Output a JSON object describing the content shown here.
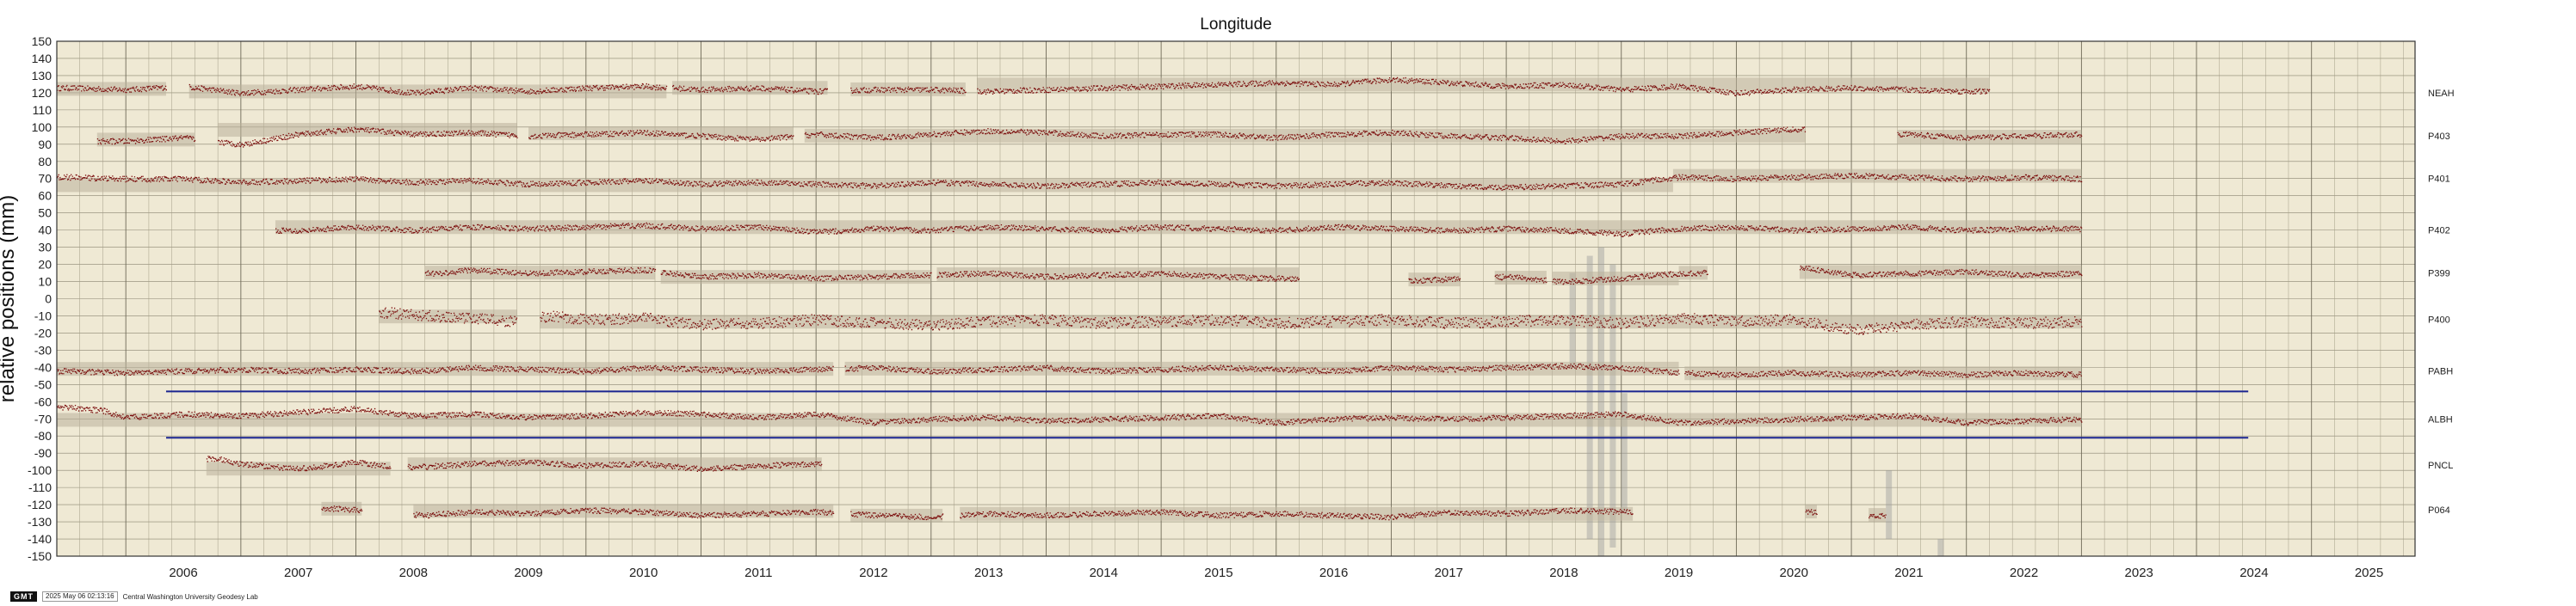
{
  "chart_data": {
    "type": "scatter",
    "title": "Longitude",
    "ylabel": "relative positions (mm)",
    "xlabel": "",
    "xlim": [
      2005.4,
      2025.9
    ],
    "ylim": [
      -150,
      150
    ],
    "x_ticks": [
      "2006",
      "2007",
      "2008",
      "2009",
      "2010",
      "2011",
      "2012",
      "2013",
      "2014",
      "2015",
      "2016",
      "2017",
      "2018",
      "2019",
      "2020",
      "2021",
      "2022",
      "2023",
      "2024",
      "2025"
    ],
    "y_ticks": [
      150,
      140,
      130,
      120,
      110,
      100,
      90,
      80,
      70,
      60,
      50,
      40,
      30,
      20,
      10,
      0,
      -10,
      -20,
      -30,
      -40,
      -50,
      -60,
      -70,
      -80,
      -90,
      -100,
      -110,
      -120,
      -130,
      -140,
      -150
    ],
    "grid": true,
    "background": "#efe9d4",
    "point_color": "#7a0a0a",
    "band_color": "#9e9e9e",
    "reference_line_color": "#1a2490",
    "series": [
      {
        "name": "NEAH",
        "offset": 120,
        "spans": [
          [
            2005.4,
            2006.35
          ],
          [
            2006.55,
            2010.7
          ],
          [
            2010.75,
            2012.1
          ],
          [
            2012.3,
            2013.3
          ],
          [
            2013.4,
            2022.2
          ]
        ],
        "x": [
          2005.5,
          2006.0,
          2006.5,
          2007.0,
          2007.5,
          2008.0,
          2008.5,
          2009.0,
          2009.5,
          2010.0,
          2010.5,
          2011.0,
          2011.5,
          2012.0,
          2012.5,
          2013.0,
          2013.5,
          2014.0,
          2014.5,
          2015.0,
          2015.5,
          2016.0,
          2016.5,
          2017.0,
          2017.5,
          2018.0,
          2018.5,
          2019.0,
          2019.5,
          2020.0,
          2020.5,
          2021.0,
          2021.5,
          2022.0
        ],
        "y": [
          123,
          122,
          124,
          120,
          122,
          124,
          120,
          123,
          121,
          123,
          124,
          122,
          123,
          121,
          122,
          122,
          121,
          122,
          123,
          124,
          125,
          126,
          125,
          128,
          126,
          124,
          125,
          122,
          124,
          120,
          122,
          123,
          122,
          121
        ]
      },
      {
        "name": "P403",
        "offset": 95,
        "spans": [
          [
            2005.75,
            2006.6
          ],
          [
            2006.8,
            2009.4
          ],
          [
            2009.5,
            2011.8
          ],
          [
            2011.9,
            2020.6
          ],
          [
            2021.4,
            2023.0
          ]
        ],
        "x": [
          2006.0,
          2006.5,
          2007.0,
          2007.5,
          2008.0,
          2008.5,
          2009.0,
          2009.5,
          2010.0,
          2010.5,
          2011.0,
          2011.5,
          2012.0,
          2012.5,
          2013.0,
          2013.5,
          2014.0,
          2014.5,
          2015.0,
          2015.5,
          2016.0,
          2016.5,
          2017.0,
          2017.5,
          2018.0,
          2018.5,
          2019.0,
          2019.5,
          2020.0,
          2020.5,
          2021.5,
          2022.0,
          2022.5,
          2023.0
        ],
        "y": [
          92,
          94,
          90,
          96,
          99,
          96,
          97,
          95,
          96,
          97,
          95,
          93,
          96,
          94,
          96,
          98,
          97,
          95,
          96,
          96,
          94,
          96,
          97,
          95,
          94,
          92,
          95,
          95,
          97,
          99,
          96,
          94,
          95,
          96
        ]
      },
      {
        "name": "P401",
        "offset": 70,
        "spans": [
          [
            2005.4,
            2019.45
          ],
          [
            2019.45,
            2023.0
          ]
        ],
        "x": [
          2005.5,
          2006.0,
          2006.5,
          2007.0,
          2007.5,
          2008.0,
          2008.5,
          2009.0,
          2009.5,
          2010.0,
          2010.5,
          2011.0,
          2011.5,
          2012.0,
          2012.5,
          2013.0,
          2013.5,
          2014.0,
          2014.5,
          2015.0,
          2015.5,
          2016.0,
          2016.5,
          2017.0,
          2017.5,
          2018.0,
          2018.5,
          2019.0,
          2019.5,
          2020.0,
          2020.5,
          2021.0,
          2021.5,
          2022.0,
          2022.5,
          2023.0
        ],
        "y": [
          71,
          70,
          70,
          68,
          69,
          70,
          68,
          69,
          67,
          68,
          69,
          67,
          68,
          67,
          66,
          68,
          67,
          66,
          67,
          68,
          67,
          66,
          67,
          68,
          66,
          65,
          66,
          67,
          71,
          70,
          71,
          72,
          71,
          70,
          71,
          70
        ]
      },
      {
        "name": "P402",
        "offset": 40,
        "spans": [
          [
            2007.3,
            2023.0
          ]
        ],
        "x": [
          2007.5,
          2008.0,
          2008.5,
          2009.0,
          2009.5,
          2010.0,
          2010.5,
          2011.0,
          2011.5,
          2012.0,
          2012.5,
          2013.0,
          2013.5,
          2014.0,
          2014.5,
          2015.0,
          2015.5,
          2016.0,
          2016.5,
          2017.0,
          2017.5,
          2018.0,
          2018.5,
          2019.0,
          2019.5,
          2020.0,
          2020.5,
          2021.0,
          2021.5,
          2022.0,
          2022.5,
          2023.0
        ],
        "y": [
          40,
          42,
          40,
          42,
          41,
          42,
          43,
          41,
          42,
          39,
          41,
          40,
          42,
          41,
          40,
          42,
          41,
          40,
          42,
          41,
          40,
          41,
          40,
          38,
          41,
          42,
          40,
          41,
          42,
          40,
          41,
          41
        ]
      },
      {
        "name": "P399",
        "offset": 15,
        "spans": [
          [
            2008.6,
            2010.6
          ],
          [
            2010.65,
            2013.0
          ],
          [
            2013.05,
            2016.2
          ],
          [
            2017.15,
            2017.6
          ],
          [
            2017.9,
            2018.35
          ],
          [
            2018.4,
            2019.5
          ],
          [
            2019.5,
            2019.75
          ],
          [
            2020.55,
            2023.0
          ]
        ],
        "x": [
          2008.7,
          2009.0,
          2009.5,
          2010.0,
          2010.5,
          2011.0,
          2011.5,
          2012.0,
          2012.5,
          2013.0,
          2013.5,
          2014.0,
          2014.5,
          2015.0,
          2015.5,
          2016.0,
          2017.3,
          2018.0,
          2018.5,
          2019.0,
          2019.3,
          2019.6,
          2020.6,
          2021.0,
          2021.5,
          2022.0,
          2022.5,
          2023.0
        ],
        "y": [
          15,
          17,
          15,
          16,
          17,
          13,
          14,
          12,
          13,
          14,
          15,
          13,
          14,
          15,
          13,
          12,
          11,
          13,
          10,
          12,
          14,
          15,
          18,
          14,
          15,
          16,
          14,
          15
        ]
      },
      {
        "name": "P400",
        "offset": -12,
        "spans": [
          [
            2008.2,
            2009.4
          ],
          [
            2009.6,
            2023.0
          ]
        ],
        "x": [
          2008.3,
          2008.7,
          2009.0,
          2009.3,
          2009.7,
          2010.0,
          2010.5,
          2011.0,
          2011.5,
          2012.0,
          2012.5,
          2013.0,
          2013.5,
          2014.0,
          2014.5,
          2015.0,
          2015.5,
          2016.0,
          2016.5,
          2017.0,
          2017.5,
          2018.0,
          2018.5,
          2019.0,
          2019.5,
          2020.0,
          2020.5,
          2021.0,
          2021.5,
          2022.0,
          2022.5,
          2023.0
        ],
        "y": [
          -8,
          -10,
          -11,
          -13,
          -10,
          -12,
          -11,
          -15,
          -14,
          -12,
          -14,
          -15,
          -13,
          -12,
          -14,
          -13,
          -12,
          -14,
          -13,
          -12,
          -14,
          -13,
          -12,
          -14,
          -11,
          -13,
          -12,
          -18,
          -15,
          -13,
          -14,
          -13
        ]
      },
      {
        "name": "PABH",
        "offset": -42,
        "spans": [
          [
            2005.4,
            2012.15
          ],
          [
            2012.25,
            2019.5
          ],
          [
            2019.55,
            2023.0
          ]
        ],
        "x": [
          2005.5,
          2006.0,
          2006.5,
          2007.0,
          2007.5,
          2008.0,
          2008.5,
          2009.0,
          2009.5,
          2010.0,
          2010.5,
          2011.0,
          2011.5,
          2012.0,
          2012.5,
          2013.0,
          2013.5,
          2014.0,
          2014.5,
          2015.0,
          2015.5,
          2016.0,
          2016.5,
          2017.0,
          2017.5,
          2018.0,
          2018.5,
          2019.0,
          2019.5,
          2020.0,
          2020.5,
          2021.0,
          2021.5,
          2022.0,
          2022.5,
          2023.0
        ],
        "y": [
          -42,
          -43,
          -42,
          -41,
          -42,
          -41,
          -42,
          -40,
          -41,
          -42,
          -40,
          -41,
          -42,
          -41,
          -40,
          -42,
          -41,
          -40,
          -42,
          -41,
          -40,
          -41,
          -42,
          -40,
          -41,
          -40,
          -39,
          -40,
          -43,
          -44,
          -43,
          -44,
          -43,
          -44,
          -43,
          -44
        ]
      },
      {
        "name": "ALBH",
        "offset": -70,
        "spans": [
          [
            2005.4,
            2023.0
          ]
        ],
        "x": [
          2005.5,
          2005.8,
          2006.0,
          2006.5,
          2007.0,
          2007.5,
          2008.0,
          2008.5,
          2009.0,
          2009.5,
          2010.0,
          2010.5,
          2011.0,
          2011.5,
          2012.0,
          2012.5,
          2013.0,
          2013.5,
          2014.0,
          2014.5,
          2015.0,
          2015.5,
          2016.0,
          2016.5,
          2017.0,
          2017.5,
          2018.0,
          2018.5,
          2019.0,
          2019.5,
          2020.0,
          2020.5,
          2021.0,
          2021.5,
          2022.0,
          2022.5,
          2023.0
        ],
        "y": [
          -63,
          -65,
          -69,
          -67,
          -68,
          -66,
          -64,
          -68,
          -67,
          -69,
          -68,
          -66,
          -67,
          -69,
          -67,
          -72,
          -70,
          -69,
          -71,
          -70,
          -69,
          -68,
          -72,
          -70,
          -69,
          -70,
          -69,
          -68,
          -67,
          -72,
          -71,
          -70,
          -69,
          -68,
          -72,
          -71,
          -70
        ]
      },
      {
        "name": "PNCL",
        "offset": -97,
        "spans": [
          [
            2006.7,
            2008.3
          ],
          [
            2008.45,
            2012.05
          ]
        ],
        "x": [
          2006.8,
          2007.0,
          2007.5,
          2008.0,
          2008.2,
          2008.5,
          2009.0,
          2009.5,
          2010.0,
          2010.5,
          2011.0,
          2011.5,
          2012.0
        ],
        "y": [
          -93,
          -96,
          -99,
          -95,
          -97,
          -98,
          -96,
          -95,
          -97,
          -96,
          -99,
          -97,
          -96
        ]
      },
      {
        "name": "P064",
        "offset": -123,
        "spans": [
          [
            2007.7,
            2008.05
          ],
          [
            2008.5,
            2012.15
          ],
          [
            2012.3,
            2013.1
          ],
          [
            2013.25,
            2019.1
          ],
          [
            2020.6,
            2020.7
          ],
          [
            2021.15,
            2021.3
          ]
        ],
        "x": [
          2007.8,
          2008.0,
          2008.6,
          2009.0,
          2009.5,
          2010.0,
          2010.5,
          2011.0,
          2011.5,
          2012.0,
          2012.5,
          2013.0,
          2013.5,
          2014.0,
          2014.5,
          2015.0,
          2015.5,
          2016.0,
          2016.5,
          2017.0,
          2017.5,
          2018.0,
          2018.5,
          2019.0,
          2020.65,
          2021.2
        ],
        "y": [
          -122,
          -123,
          -126,
          -124,
          -125,
          -123,
          -124,
          -126,
          -125,
          -124,
          -126,
          -127,
          -125,
          -126,
          -125,
          -124,
          -126,
          -125,
          -126,
          -127,
          -124,
          -125,
          -123,
          -124,
          -124,
          -126
        ]
      }
    ],
    "reference_lines": [
      {
        "y": -54,
        "x_range": [
          2006.35,
          2024.45
        ]
      },
      {
        "y": -81,
        "x_range": [
          2006.35,
          2024.45
        ]
      }
    ]
  },
  "footer": {
    "logo": "GMT",
    "timestamp": "2025 May 06 02:13:16",
    "lab": "Central Washington University Geodesy Lab"
  }
}
